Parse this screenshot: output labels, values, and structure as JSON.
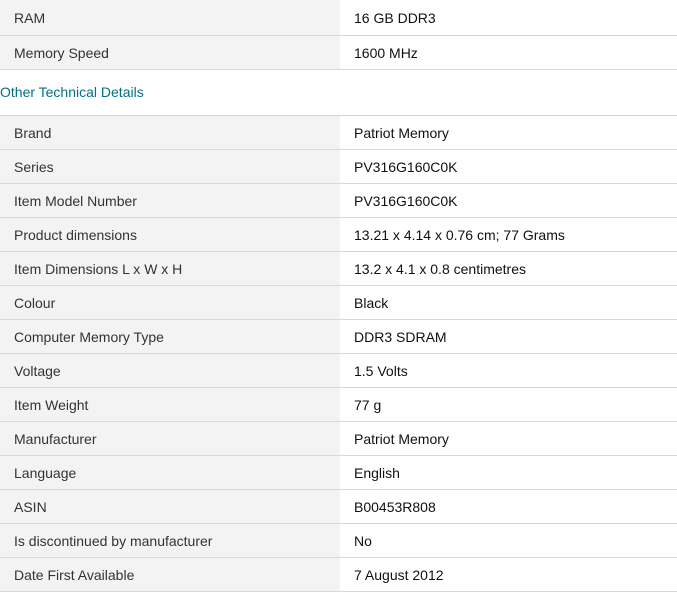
{
  "top_specs": [
    {
      "label": "RAM",
      "value": "16 GB DDR3"
    },
    {
      "label": "Memory Speed",
      "value": "1600 MHz"
    }
  ],
  "other_details": {
    "heading": "Other Technical Details",
    "rows": [
      {
        "label": "Brand",
        "value": "Patriot Memory"
      },
      {
        "label": "Series",
        "value": "PV316G160C0K"
      },
      {
        "label": "Item Model Number",
        "value": "PV316G160C0K"
      },
      {
        "label": "Product dimensions",
        "value": "13.21 x 4.14 x 0.76 cm; 77 Grams"
      },
      {
        "label": "Item Dimensions L x W x H",
        "value": "13.2 x 4.1 x 0.8 centimetres"
      },
      {
        "label": "Colour",
        "value": "Black"
      },
      {
        "label": "Computer Memory Type",
        "value": "DDR3 SDRAM"
      },
      {
        "label": "Voltage",
        "value": "1.5 Volts"
      },
      {
        "label": "Item Weight",
        "value": "77 g"
      },
      {
        "label": "Manufacturer",
        "value": "Patriot Memory"
      },
      {
        "label": "Language",
        "value": "English"
      },
      {
        "label": "ASIN",
        "value": "B00453R808"
      },
      {
        "label": "Is discontinued by manufacturer",
        "value": "No"
      },
      {
        "label": "Date First Available",
        "value": "7 August 2012"
      }
    ]
  }
}
